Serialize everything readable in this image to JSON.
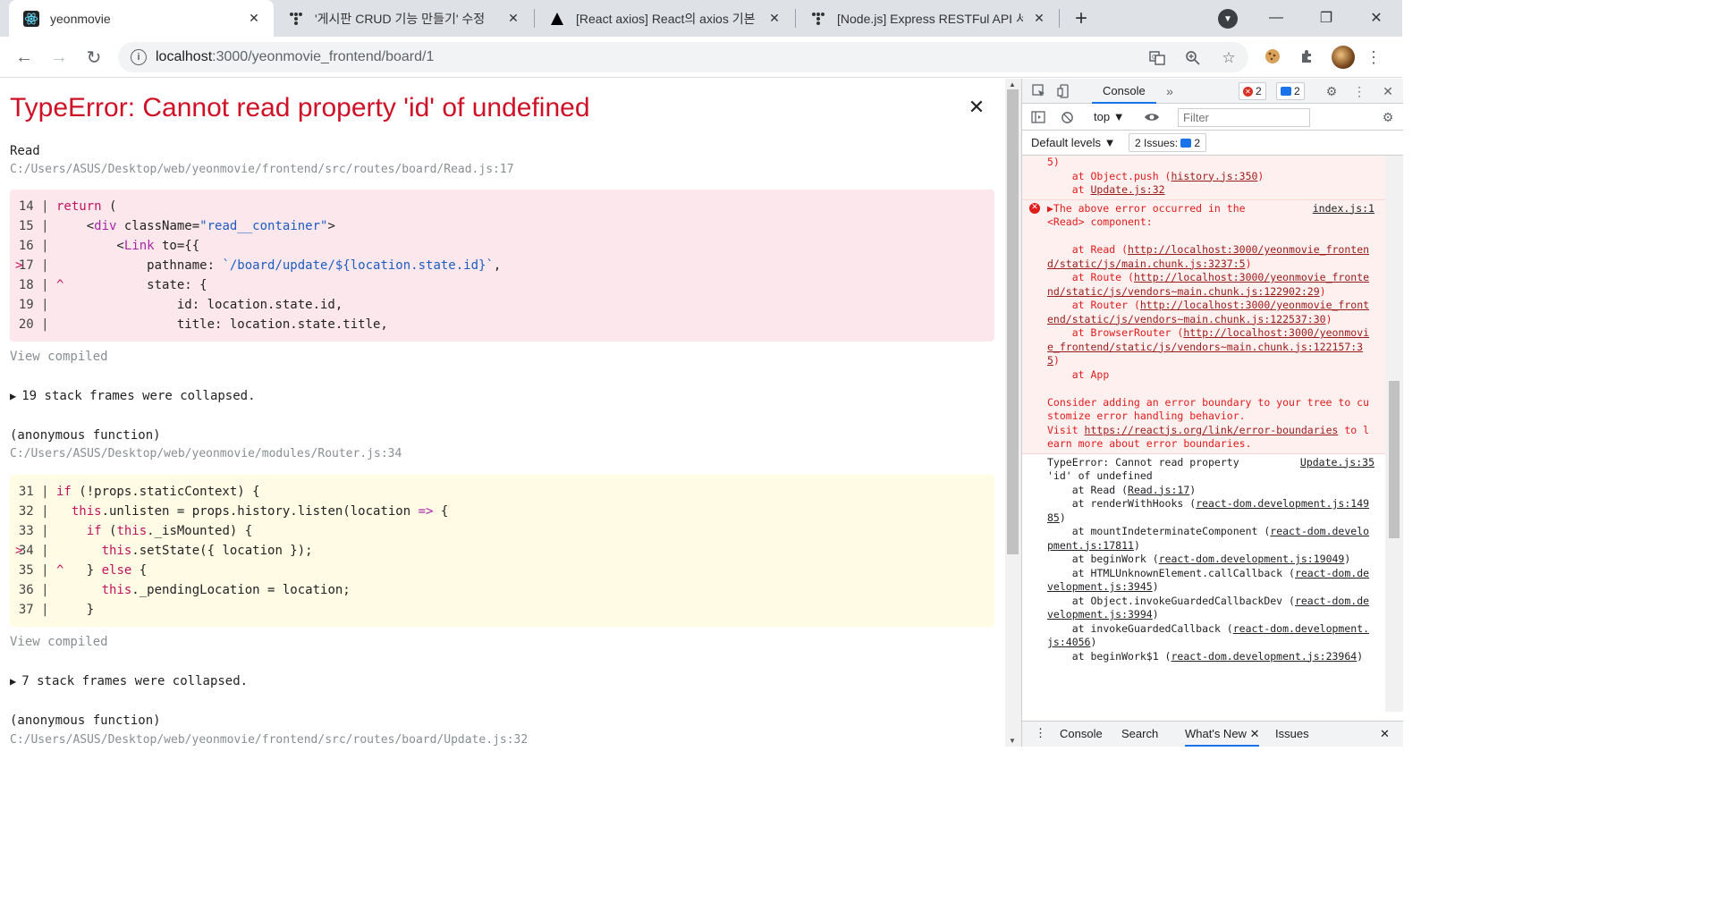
{
  "tabs": [
    {
      "title": "yeonmovie",
      "icon": "react-icon",
      "active": true
    },
    {
      "title": "'게시판 CRUD 기능 만들기' 수정",
      "icon": "velog-icon",
      "active": false
    },
    {
      "title": "[React axios] React의 axios 기본",
      "icon": "triangle-icon",
      "active": false
    },
    {
      "title": "[Node.js] Express RESTFul API 서",
      "icon": "velog-icon",
      "active": false
    }
  ],
  "address": {
    "host": "localhost",
    "path": ":3000/yeonmovie_frontend/board/1"
  },
  "error": {
    "title": "TypeError: Cannot read property 'id' of undefined",
    "frames": [
      {
        "name": "Read",
        "path": "C:/Users/ASUS/Desktop/web/yeonmovie/frontend/src/routes/board/Read.js:17"
      },
      {
        "name": "(anonymous function)",
        "path": "C:/Users/ASUS/Desktop/web/yeonmovie/modules/Router.js:34"
      },
      {
        "name": "(anonymous function)",
        "path": "C:/Users/ASUS/Desktop/web/yeonmovie/frontend/src/routes/board/Update.js:32"
      }
    ],
    "view_compiled": "View compiled",
    "collapsed1": "19 stack frames were collapsed.",
    "collapsed2": "7 stack frames were collapsed."
  },
  "devtools": {
    "tab_console": "Console",
    "badge_errors": "2",
    "badge_messages": "2",
    "context": "top",
    "filter_placeholder": "Filter",
    "levels": "Default levels",
    "issues_label": "2 Issues:",
    "issues_count": "2",
    "drawer": [
      "Console",
      "Search",
      "What's New",
      "Issues"
    ]
  },
  "colors": {
    "error_red": "#ce1126",
    "accent_blue": "#1a73e8"
  }
}
